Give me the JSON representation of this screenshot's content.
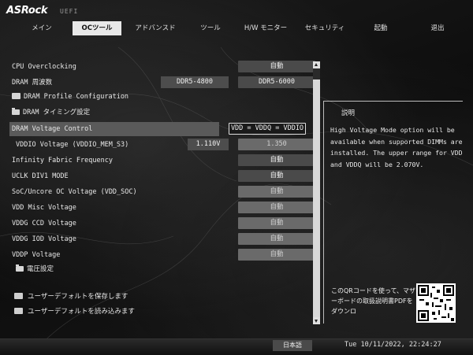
{
  "header": {
    "brand": "ASRock",
    "subtitle": "UEFI"
  },
  "nav": {
    "tabs": [
      {
        "label": "メイン",
        "active": false
      },
      {
        "label": "OCツール",
        "active": true
      },
      {
        "label": "アドバンスド",
        "active": false
      },
      {
        "label": "ツール",
        "active": false
      },
      {
        "label": "H/W モニター",
        "active": false
      },
      {
        "label": "セキュリティ",
        "active": false
      },
      {
        "label": "起動",
        "active": false
      },
      {
        "label": "退出",
        "active": false
      }
    ]
  },
  "settings": {
    "cpu_oc": {
      "label": "CPU Overclocking",
      "value": "自動"
    },
    "dram_freq": {
      "label": "DRAM 周波数",
      "current": "DDR5-4800",
      "value": "DDR5-6000"
    },
    "dram_profile": {
      "label": "DRAM Profile Configuration"
    },
    "dram_timing": {
      "label": "DRAM タイミング設定"
    },
    "dram_voltage_control": {
      "label": "DRAM Voltage Control",
      "value": "VDD = VDDQ = VDDIO"
    },
    "vddio_voltage": {
      "label": "VDDIO Voltage (VDDIO_MEM_S3)",
      "current": "1.110V",
      "value": "1.350"
    },
    "infinity_fabric": {
      "label": "Infinity Fabric Frequency",
      "value": "自動"
    },
    "uclk": {
      "label": "UCLK DIV1 MODE",
      "value": "自動"
    },
    "soc_voltage": {
      "label": "SoC/Uncore OC Voltage (VDD_SOC)",
      "value": "自動"
    },
    "vdd_misc": {
      "label": "VDD Misc Voltage",
      "value": "自動"
    },
    "vddg_ccd": {
      "label": "VDDG CCD Voltage",
      "value": "自動"
    },
    "vddg_iod": {
      "label": "VDDG IOD Voltage",
      "value": "自動"
    },
    "vddp": {
      "label": "VDDP Voltage",
      "value": "自動"
    },
    "voltage_settings": {
      "label": "電圧設定"
    },
    "save_defaults": {
      "label": "ユーザーデフォルトを保存します"
    },
    "load_defaults": {
      "label": "ユーザーデフォルトを読み込みます"
    }
  },
  "help": {
    "title": "説明",
    "text": "High Voltage Mode option will be available when supported DIMMs are installed. The upper range for VDD and VDDQ will be 2.070V.",
    "qr_text": "このQRコードを使って、マザーボードの取扱説明書PDFをダウンロ"
  },
  "footer": {
    "language": "日本語",
    "datetime": "Tue 10/11/2022, 22:24:27"
  },
  "colors": {
    "active_tab": "#e8e8e8",
    "value_box": "#4a4a4a",
    "selected_row": "#5a5a5a"
  }
}
